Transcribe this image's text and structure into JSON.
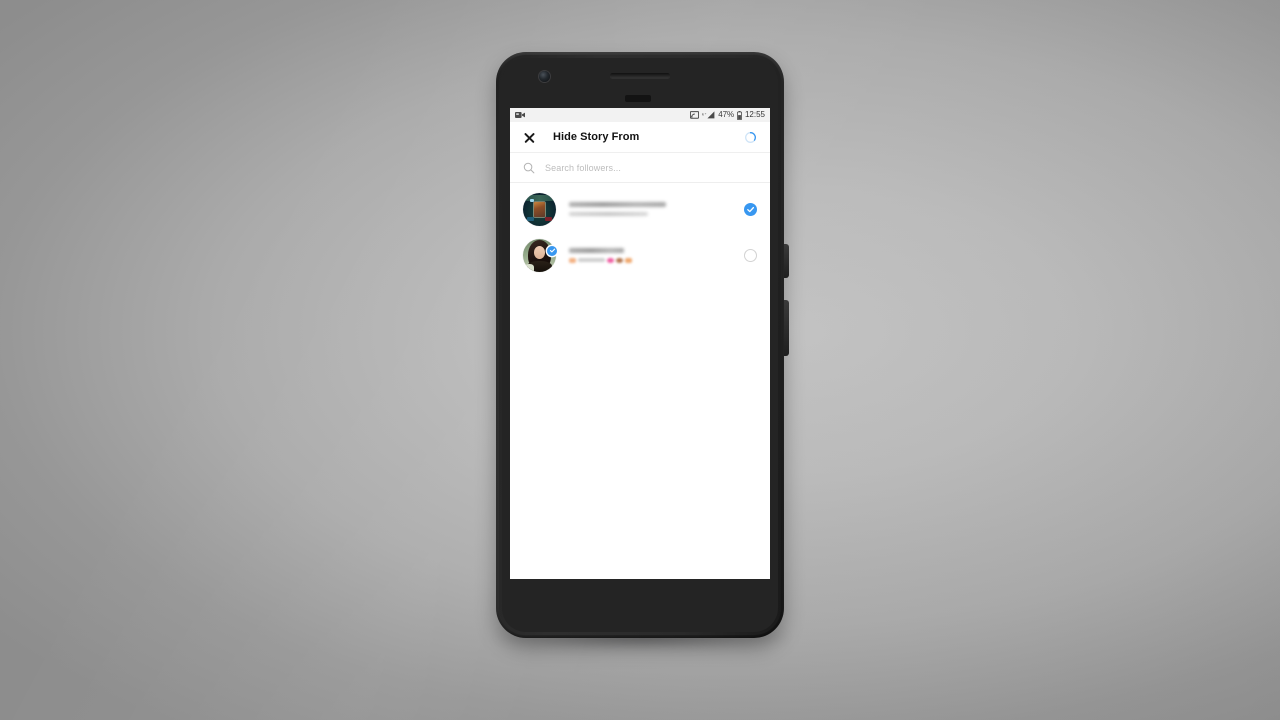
{
  "device": {
    "name": "android-smartphone-mockup",
    "buttons": [
      "power-button",
      "volume-button"
    ]
  },
  "statusbar": {
    "recording_icon": "video-recording-icon",
    "cast_icon": "screen-cast-icon",
    "network_icon": "mobile-signal-icon",
    "battery_percent": "47%",
    "battery_icon": "battery-icon",
    "time": "12:55"
  },
  "navbar": {
    "close_icon": "close-icon",
    "title": "Hide Story From",
    "spinner": "loading-spinner-icon",
    "accent_color": "#3897f0"
  },
  "search": {
    "icon": "search-icon",
    "placeholder": "Search followers...",
    "value": ""
  },
  "list": {
    "rows": [
      {
        "avatar": "avatar-gaming-artwork",
        "username": "",
        "fullname": "",
        "censored": true,
        "verified": false,
        "selected": true,
        "control": "checkbox-selected"
      },
      {
        "avatar": "avatar-portrait-photo",
        "username": "",
        "fullname": "",
        "censored": true,
        "verified": true,
        "selected": false,
        "control": "checkbox-unselected"
      }
    ]
  },
  "colors": {
    "instagram_blue": "#3897f0",
    "screen_background": "#ffffff",
    "statusbar_background": "#f2f2f2",
    "placeholder_gray": "#bdbdbd"
  }
}
